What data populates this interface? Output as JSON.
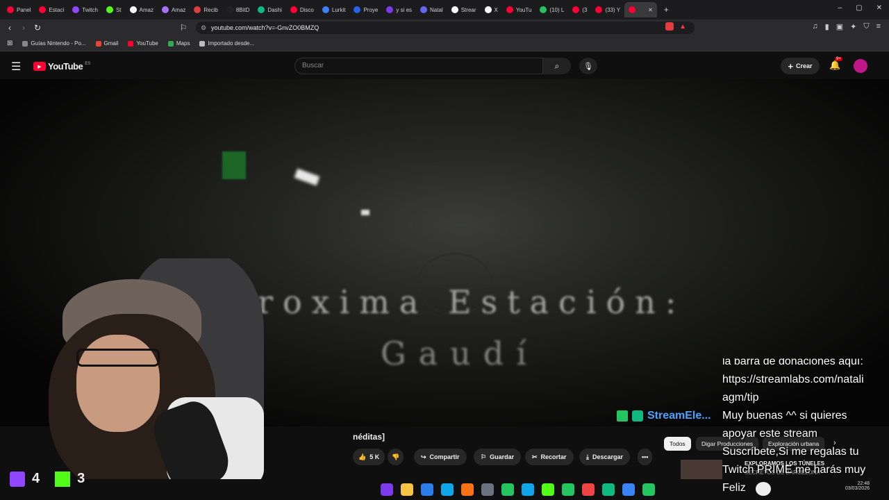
{
  "tabs": [
    {
      "label": "Panel",
      "color": "#ff0033"
    },
    {
      "label": "Estaci",
      "color": "#ff0033"
    },
    {
      "label": "Twitch",
      "color": "#9147ff"
    },
    {
      "label": "St",
      "color": "#53fc18"
    },
    {
      "label": "Amaz",
      "color": "#ffffff"
    },
    {
      "label": "Amaz",
      "color": "#a970ff"
    },
    {
      "label": "Recib",
      "color": "#e03e3e"
    },
    {
      "label": "8BitD",
      "color": "#222222"
    },
    {
      "label": "Dashi",
      "color": "#10b981"
    },
    {
      "label": "Disco",
      "color": "#ff0033"
    },
    {
      "label": "Lurkit",
      "color": "#3b82f6"
    },
    {
      "label": "Proye",
      "color": "#2563eb"
    },
    {
      "label": "y si es",
      "color": "#7c3aed"
    },
    {
      "label": "Natal",
      "color": "#6366f1"
    },
    {
      "label": "Strear",
      "color": "#ffffff"
    },
    {
      "label": "X",
      "color": "#ffffff"
    },
    {
      "label": "YouTu",
      "color": "#ff0033"
    },
    {
      "label": "(10) L",
      "color": "#22c55e"
    },
    {
      "label": "(3",
      "color": "#ff0033"
    },
    {
      "label": "(33) Y",
      "color": "#ff0033"
    }
  ],
  "url": "youtube.com/watch?v=-GnvZO0BMZQ",
  "bookmarks": [
    "Guías Nintendo - Po...",
    "Gmail",
    "YouTube",
    "Maps",
    "Importado desde..."
  ],
  "yt": {
    "logo": "YouTube",
    "region": "ES",
    "search_placeholder": "Buscar",
    "create_label": "Crear",
    "notif_count": "9+"
  },
  "video": {
    "title_line1": "Proxima Estación:",
    "title_line2": "Gaudí"
  },
  "below": {
    "title_fragment": "néditas]",
    "like_count": "5 K",
    "share": "Compartir",
    "save": "Guardar",
    "clip": "Recortar",
    "download": "Descargar"
  },
  "chips": [
    "Todos",
    "Digar Producciones",
    "Exploración urbana"
  ],
  "recommend_title": "EXPLORAMOS LOS TÚNELES",
  "recommend_sub": "SECRETOS DE BARCELONA",
  "stream": {
    "twitch_count": "4",
    "kick_count": "3",
    "streamelements": "StreamEle..."
  },
  "chat_lines": [
    "la barra de donaciones aquí:",
    "https://streamlabs.com/natali",
    "agm/tip",
    "Muy buenas ^^ si quieres",
    "apoyar este stream",
    "Suscríbete,Si me regalas tu",
    "Twitch PRIME me harás muy",
    "Feliz"
  ],
  "clock": {
    "time": "22:48",
    "date": "03/03/2026"
  },
  "colors": {
    "accent": "#ff0033",
    "twitch": "#9147ff",
    "kick": "#53fc18"
  }
}
